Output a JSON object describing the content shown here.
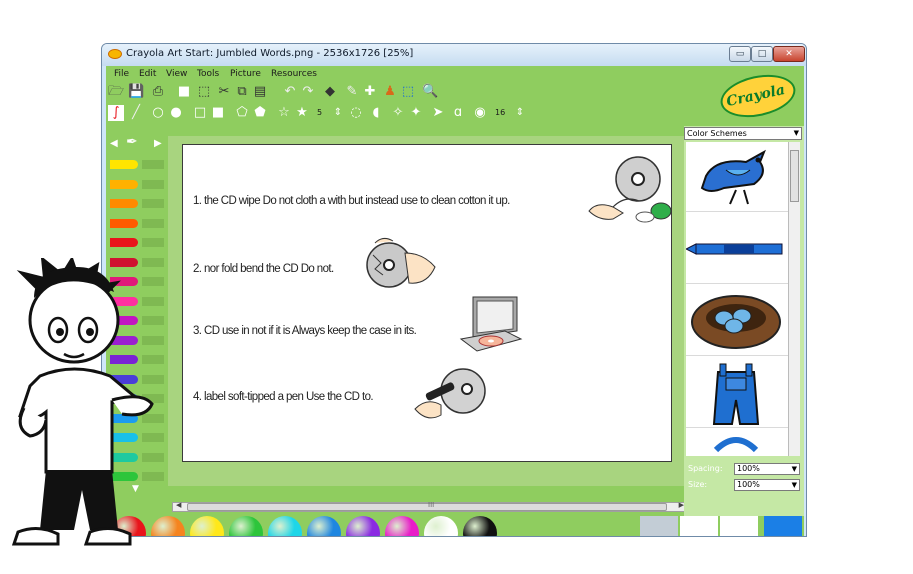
{
  "window": {
    "title": "Crayola Art Start: Jumbled Words.png - 2536x1726 [25%]",
    "controls": {
      "minimize": "▭",
      "maximize": "□",
      "close": "✕"
    }
  },
  "menubar": {
    "items": [
      "File",
      "Edit",
      "View",
      "Tools",
      "Picture",
      "Resources"
    ]
  },
  "toolbar2": {
    "star_points": "5",
    "brush_size": "16"
  },
  "logo": {
    "text": "Crayola"
  },
  "canvas": {
    "sentences": [
      "1. the CD wipe Do not cloth a with but instead use to clean cotton it up.",
      "2. nor fold bend the CD Do not.",
      "3. CD use in not if it is Always keep the case in its.",
      "4. label soft-tipped a pen Use the CD to."
    ]
  },
  "right_panel": {
    "scheme_label": "Color Schemes",
    "spacing_label": "Spacing:",
    "spacing_value": "100%",
    "size_label": "Size:",
    "size_value": "100%"
  },
  "scrollbar": {
    "grip": "III"
  },
  "colors": {
    "app_green": "#8fcd5f",
    "paints": [
      "#e8141b",
      "#f5841f",
      "#ffe81a",
      "#2dc53b",
      "#1ed6e8",
      "#1f86e0",
      "#8a2be2",
      "#e81cc8",
      "#ffffff",
      "#111111"
    ],
    "crayons": [
      "#ffe500",
      "#ffb100",
      "#ff8a00",
      "#ff5a00",
      "#e8141b",
      "#cf1230",
      "#e0197a",
      "#ff2fa0",
      "#c215c2",
      "#9b1fd0",
      "#7a23d4",
      "#4a3fd8",
      "#2a63e0",
      "#1c9cf0",
      "#19c0e8",
      "#1ec9a0",
      "#2dc53b"
    ],
    "swatches": [
      "#c3cdd6",
      "#ffffff",
      "#ffffff",
      "#1b7fe6"
    ]
  }
}
